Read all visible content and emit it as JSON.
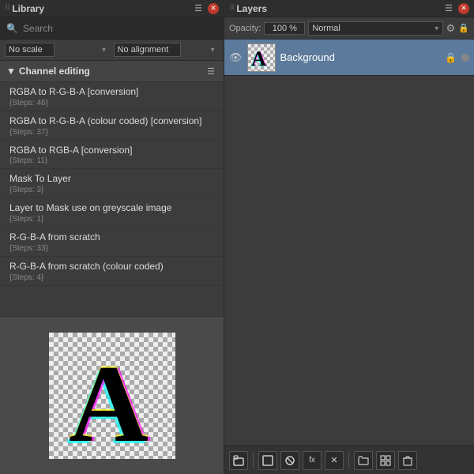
{
  "left_panel": {
    "title": "Library",
    "search_placeholder": "Search",
    "no_scale_label": "No scale",
    "no_alignment_label": "No alignment",
    "category": {
      "label": "Channel editing",
      "items": [
        {
          "name": "RGBA to R-G-B-A [conversion]",
          "steps": "{Steps: 46}"
        },
        {
          "name": "RGBA to R-G-B-A (colour coded) [conversion]",
          "steps": "{Steps: 37}"
        },
        {
          "name": "RGBA to RGB-A [conversion]",
          "steps": "{Steps: 11}"
        },
        {
          "name": "Mask To Layer",
          "steps": "{Steps: 3}"
        },
        {
          "name": "Layer to Mask use on greyscale image",
          "steps": "{Steps: 1}"
        },
        {
          "name": "R-G-B-A from scratch",
          "steps": "{Steps: 33}"
        },
        {
          "name": "R-G-B-A from scratch (colour coded)",
          "steps": "{Steps: 4}"
        }
      ]
    }
  },
  "right_panel": {
    "title": "Layers",
    "opacity_label": "Opacity:",
    "opacity_value": "100 %",
    "blend_mode": "Normal",
    "layer": {
      "name": "Background"
    }
  },
  "toolbar": {
    "buttons": [
      "new-group",
      "new-layer",
      "mask",
      "script",
      "trash",
      "folder",
      "grid",
      "delete"
    ]
  }
}
